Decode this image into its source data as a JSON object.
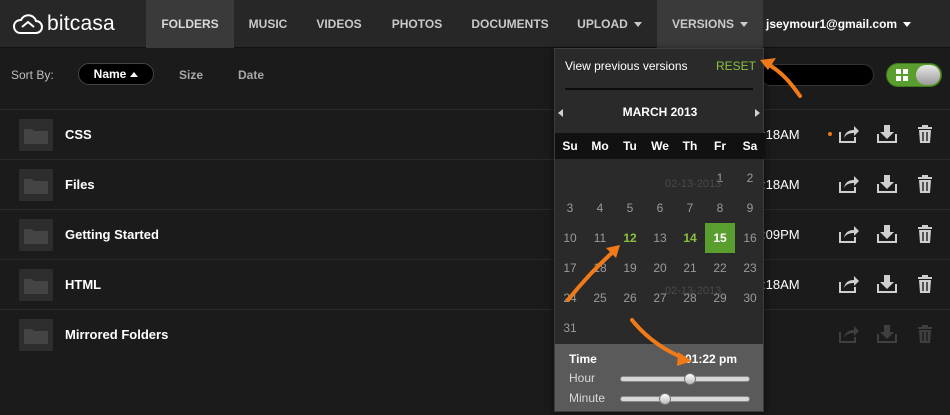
{
  "brand": {
    "name": "bitcasa"
  },
  "nav": {
    "items": [
      {
        "label": "FOLDERS"
      },
      {
        "label": "MUSIC"
      },
      {
        "label": "VIDEOS"
      },
      {
        "label": "PHOTOS"
      },
      {
        "label": "DOCUMENTS"
      },
      {
        "label": "UPLOAD"
      },
      {
        "label": "VERSIONS"
      }
    ],
    "user": "jseymour1@gmail.com"
  },
  "sort": {
    "label": "Sort By:",
    "options": [
      {
        "label": "Name",
        "active": true
      },
      {
        "label": "Size"
      },
      {
        "label": "Date"
      }
    ]
  },
  "files": [
    {
      "name": "CSS",
      "time": ":18AM"
    },
    {
      "name": "Files",
      "time": ":18AM"
    },
    {
      "name": "Getting Started",
      "time": ":09PM"
    },
    {
      "name": "HTML",
      "time": ":18AM"
    },
    {
      "name": "Mirrored Folders",
      "time": ""
    }
  ],
  "versions": {
    "heading": "View previous versions",
    "reset": "RESET",
    "month": "MARCH 2013",
    "weekdays": [
      "Su",
      "Mo",
      "Tu",
      "We",
      "Th",
      "Fr",
      "Sa"
    ],
    "weeks": [
      [
        "",
        "",
        "",
        "",
        "",
        "1",
        "2"
      ],
      [
        "3",
        "4",
        "5",
        "6",
        "7",
        "8",
        "9"
      ],
      [
        "10",
        "11",
        "12",
        "13",
        "14",
        "15",
        "16"
      ],
      [
        "17",
        "18",
        "19",
        "20",
        "21",
        "22",
        "23"
      ],
      [
        "24",
        "25",
        "26",
        "27",
        "28",
        "29",
        "30"
      ],
      [
        "31",
        "",
        "",
        "",
        "",
        "",
        ""
      ]
    ],
    "available_days": [
      "12",
      "14"
    ],
    "selected_day": "15",
    "background_dates": [
      "02-13-2013",
      "02-13-2013"
    ],
    "time": {
      "label": "Time",
      "value": "01:22 pm",
      "hour_label": "Hour",
      "minute_label": "Minute",
      "hour_position": 0.54,
      "minute_position": 0.34
    }
  },
  "colors": {
    "accent_green": "#8ac13e",
    "selected_green": "#5a9e2f",
    "annotation_orange": "#f07a18",
    "nav_bg": "#272727",
    "page_bg": "#1b1b1b"
  },
  "icons": [
    "cloud-logo-icon",
    "folder-icon",
    "share-icon",
    "download-icon",
    "trash-icon",
    "grid-view-icon"
  ]
}
